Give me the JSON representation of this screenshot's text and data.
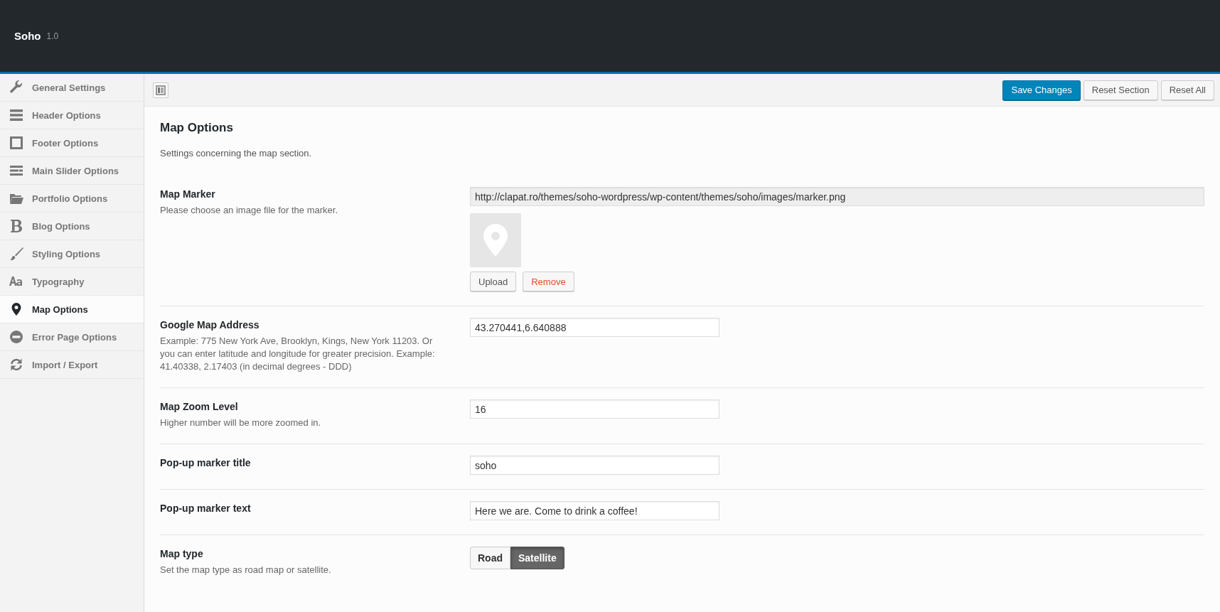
{
  "header": {
    "title": "Soho",
    "version": "1.0"
  },
  "sidebar": {
    "items": [
      {
        "label": "General Settings",
        "selected": false
      },
      {
        "label": "Header Options",
        "selected": false
      },
      {
        "label": "Footer Options",
        "selected": false
      },
      {
        "label": "Main Slider Options",
        "selected": false
      },
      {
        "label": "Portfolio Options",
        "selected": false
      },
      {
        "label": "Blog Options",
        "selected": false
      },
      {
        "label": "Styling Options",
        "selected": false
      },
      {
        "label": "Typography",
        "selected": false
      },
      {
        "label": "Map Options",
        "selected": true
      },
      {
        "label": "Error Page Options",
        "selected": false
      },
      {
        "label": "Import / Export",
        "selected": false
      }
    ]
  },
  "toolbar": {
    "buttons": [
      {
        "label": "Save Changes",
        "kind": "primary"
      },
      {
        "label": "Reset Section",
        "kind": "default"
      },
      {
        "label": "Reset All",
        "kind": "default"
      }
    ]
  },
  "section": {
    "title": "Map Options",
    "description": "Settings concerning the map section."
  },
  "fields": [
    {
      "kind": "media",
      "label": "Map Marker",
      "description": "Please choose an image file for the marker.",
      "value": "http://clapat.ro/themes/soho-wordpress/wp-content/themes/soho/images/marker.png",
      "buttons": [
        "Upload",
        "Remove"
      ]
    },
    {
      "kind": "text",
      "label": "Google Map Address",
      "description": "Example: 775 New York Ave, Brooklyn, Kings, New York 11203. Or you can enter latitude and longitude for greater precision. Example: 41.40338, 2.17403 (in decimal degrees - DDD)",
      "value": "43.270441,6.640888"
    },
    {
      "kind": "text",
      "label": "Map Zoom Level",
      "description": "Higher number will be more zoomed in.",
      "value": "16"
    },
    {
      "kind": "text",
      "label": "Pop-up marker title",
      "value": "soho"
    },
    {
      "kind": "text",
      "label": "Pop-up marker text",
      "value": "Here we are. Come to drink a coffee!"
    },
    {
      "kind": "buttonset",
      "label": "Map type",
      "description": "Set the map type as road map or satellite.",
      "options": [
        {
          "label": "Road",
          "selected": false
        },
        {
          "label": "Satellite",
          "selected": true
        }
      ]
    }
  ]
}
